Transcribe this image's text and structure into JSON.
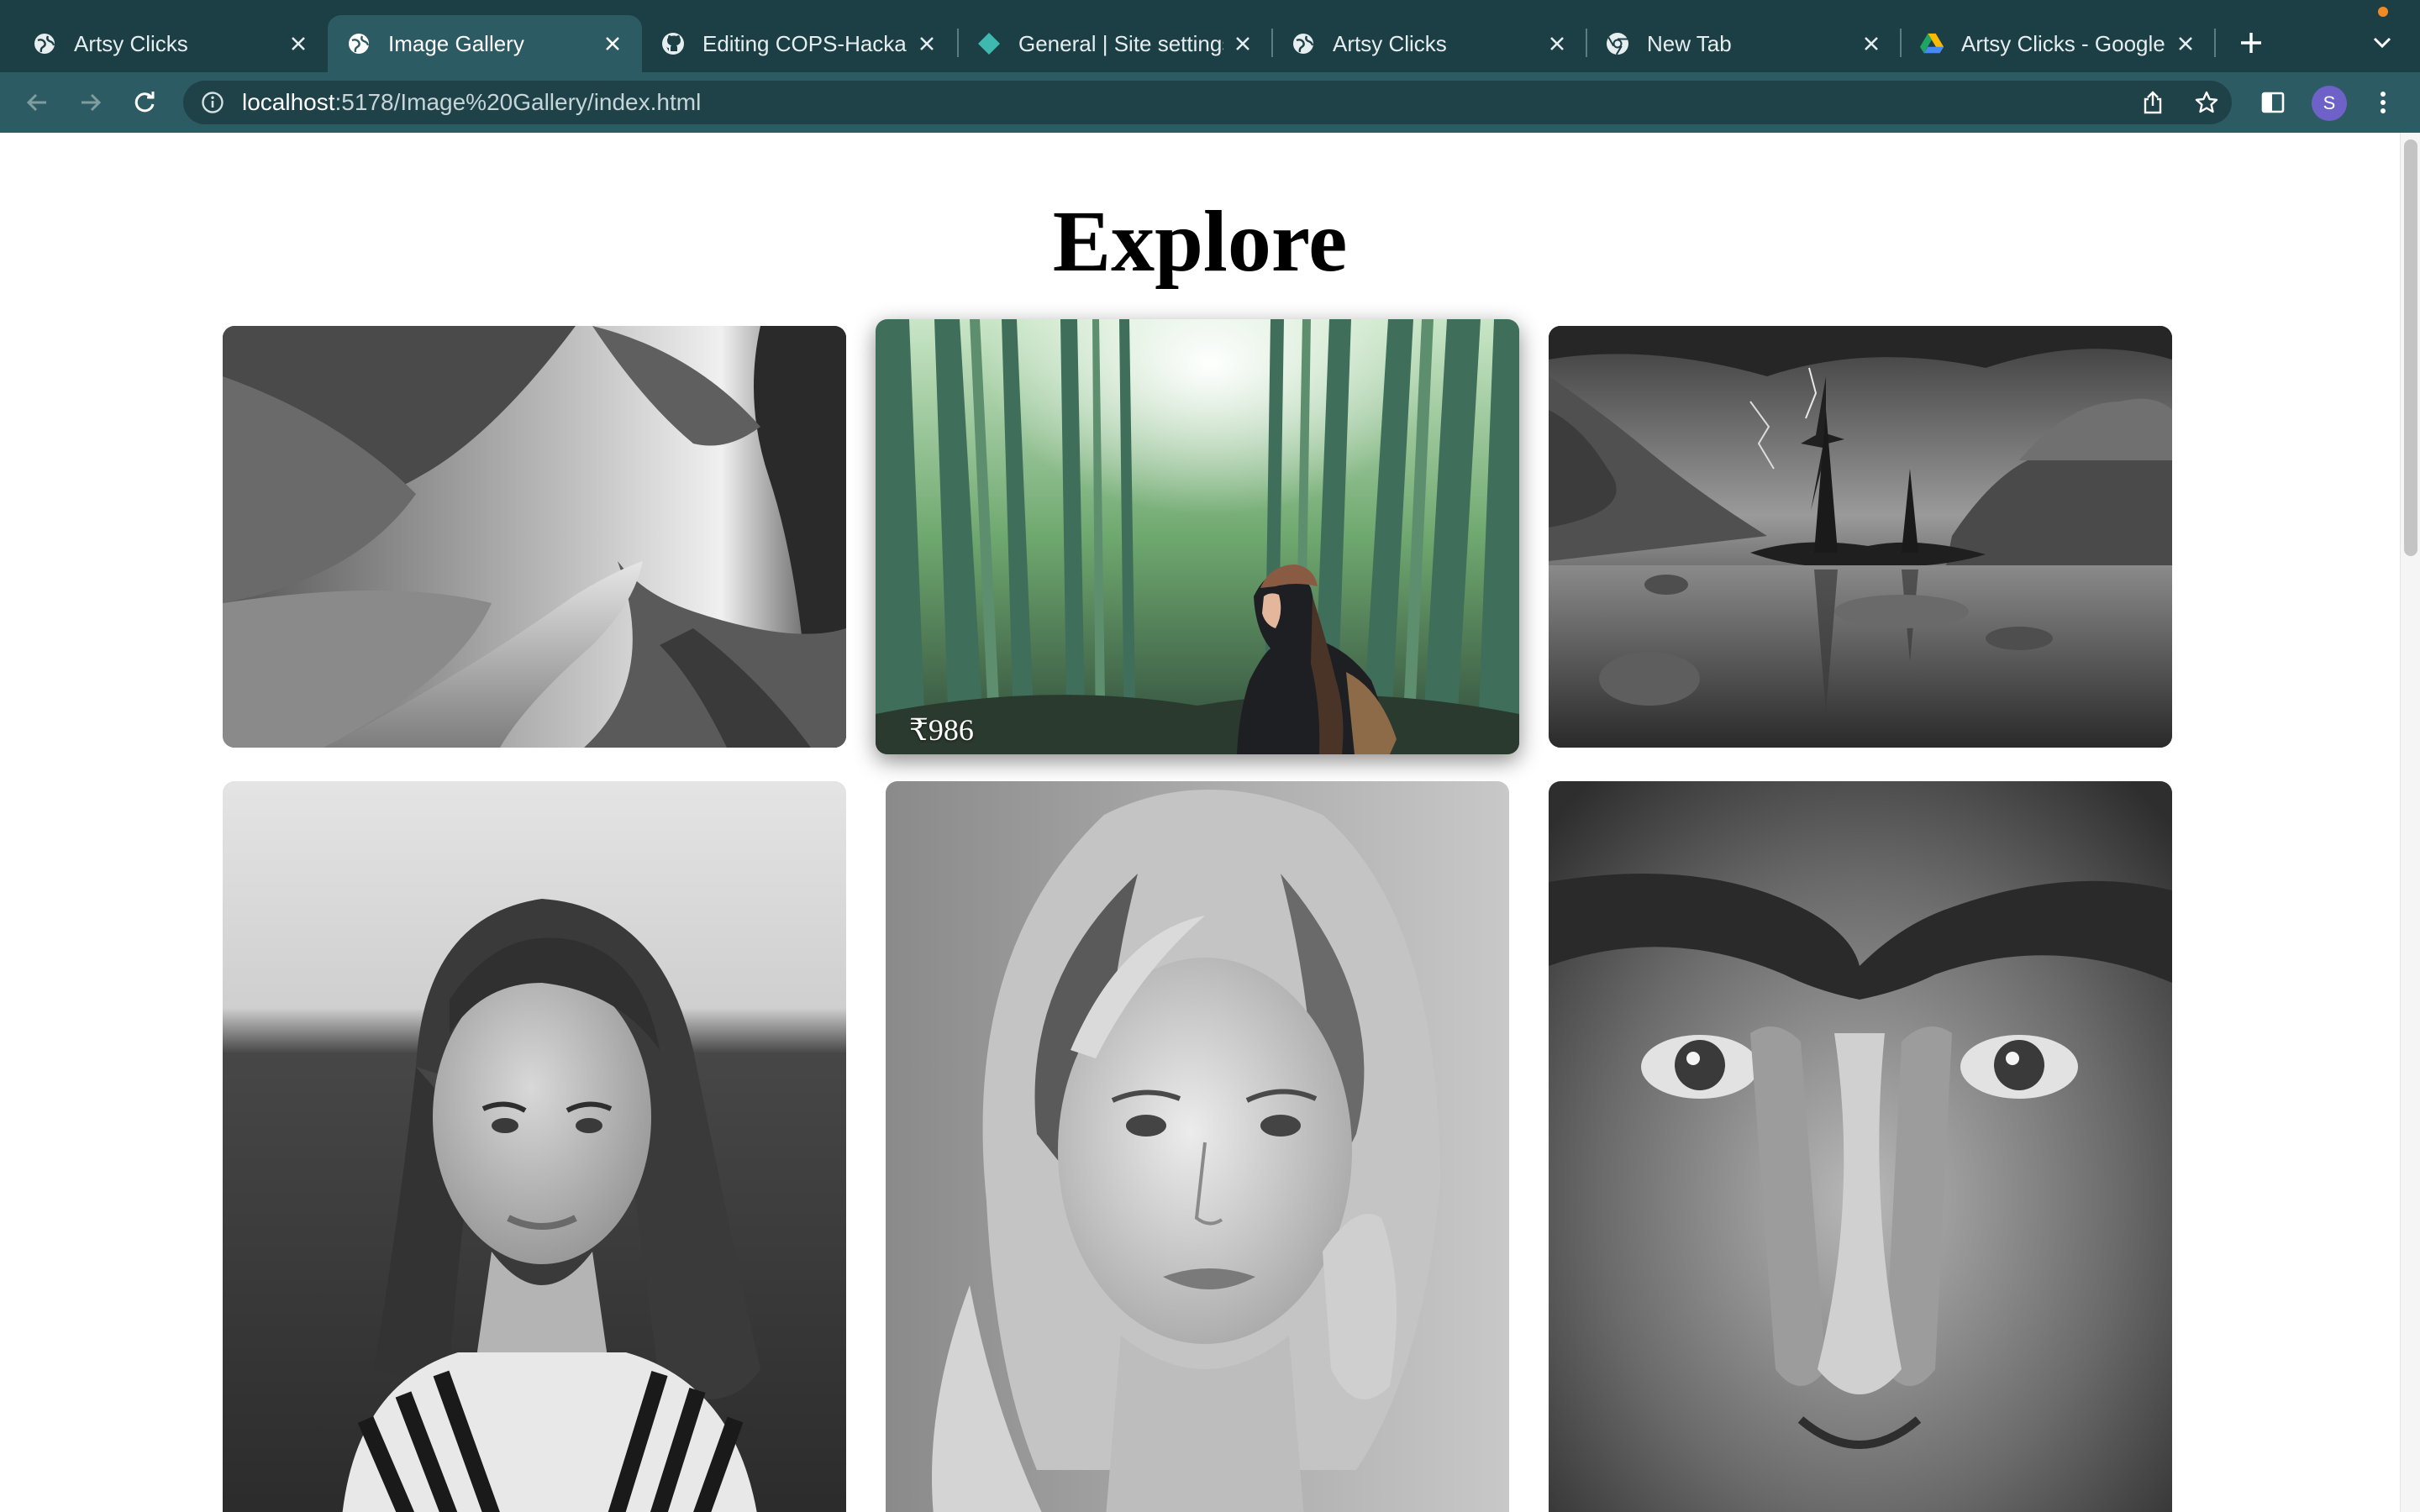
{
  "browser": {
    "tabs": [
      {
        "title": "Artsy Clicks",
        "icon": "globe-icon",
        "active": false
      },
      {
        "title": "Image Gallery",
        "icon": "globe-icon",
        "active": true
      },
      {
        "title": "Editing COPS-Hackal",
        "icon": "github-icon",
        "active": false
      },
      {
        "title": "General | Site settings",
        "icon": "netlify-icon",
        "active": false
      },
      {
        "title": "Artsy Clicks",
        "icon": "globe-icon",
        "active": false
      },
      {
        "title": "New Tab",
        "icon": "chrome-icon",
        "active": false
      },
      {
        "title": "Artsy Clicks - Google",
        "icon": "google-drive-icon",
        "active": false
      }
    ],
    "address": {
      "host": "localhost",
      "path": ":5178/Image%20Gallery/index.html"
    },
    "profile_initial": "S",
    "colors": {
      "tabstrip": "#1c3f46",
      "toolbar": "#2c5b63",
      "omnibox": "#1f4148",
      "avatar": "#6e62c9"
    }
  },
  "page": {
    "title": "Explore",
    "gallery": [
      {
        "name": "misty-forest-path",
        "tone": "grayscale",
        "price": ""
      },
      {
        "name": "bamboo-forest-woman",
        "tone": "color",
        "price": "₹986",
        "hovered": true
      },
      {
        "name": "lake-lightning-mountains",
        "tone": "grayscale",
        "price": ""
      },
      {
        "name": "portrait-woman-striped-shirt",
        "tone": "grayscale",
        "price": ""
      },
      {
        "name": "portrait-blonde-woman",
        "tone": "grayscale",
        "price": ""
      },
      {
        "name": "closeup-man-eyes-hands",
        "tone": "grayscale",
        "price": ""
      }
    ]
  }
}
